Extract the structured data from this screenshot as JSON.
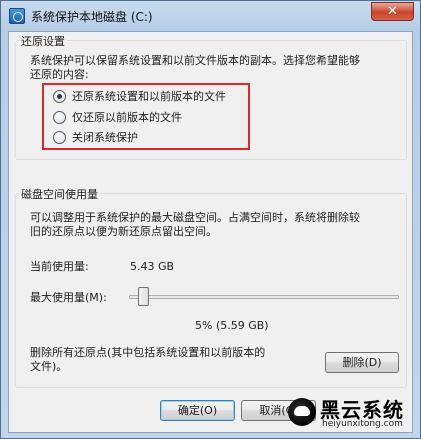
{
  "window": {
    "title": "系统保护本地磁盘 (C:)",
    "close_label": "✕"
  },
  "restore_settings": {
    "group_title": "还原设置",
    "description_line1": "系统保护可以保留系统设置和以前文件版本的副本。选择您希望能够",
    "description_line2": "还原的内容:",
    "options": [
      {
        "label": "还原系统设置和以前版本的文件",
        "selected": true
      },
      {
        "label": "仅还原以前版本的文件",
        "selected": false
      },
      {
        "label": "关闭系统保护",
        "selected": false
      }
    ]
  },
  "disk_usage": {
    "group_title": "磁盘空间使用量",
    "description_line1": "可以调整用于系统保护的最大磁盘空间。占满空间时，系统将删除较",
    "description_line2": "旧的还原点以便为新还原点留出空间。",
    "current_usage_label": "当前使用量:",
    "current_usage_value": "5.43 GB",
    "max_usage_label": "最大使用量(M):",
    "max_usage_percent": 5,
    "max_usage_value": "5% (5.59 GB)",
    "delete_description_line1": "删除所有还原点(其中包括系统设置和以前版本的",
    "delete_description_line2": "文件)。",
    "delete_button": "删除(D)"
  },
  "footer": {
    "ok_button": "确定(O)",
    "cancel_button": "取消(C)"
  },
  "watermark": {
    "title": "黑云系统",
    "url": "heiyunxitong.com"
  }
}
